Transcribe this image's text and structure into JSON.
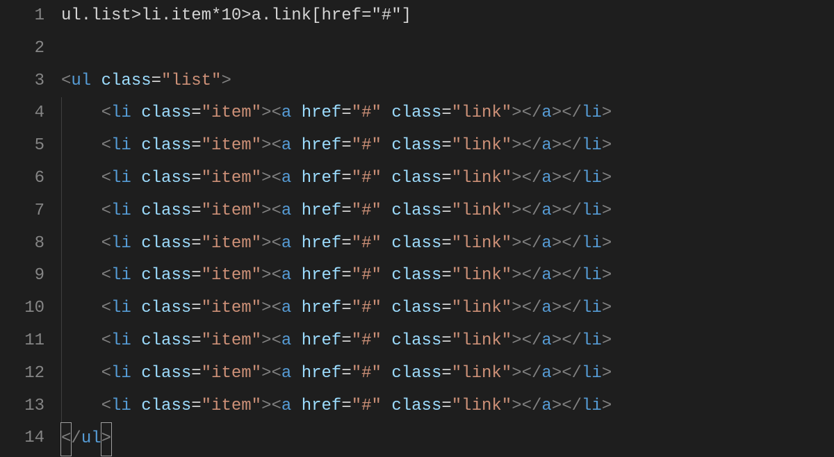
{
  "editor": {
    "line_numbers": [
      "1",
      "2",
      "3",
      "4",
      "5",
      "6",
      "7",
      "8",
      "9",
      "10",
      "11",
      "12",
      "13",
      "14"
    ],
    "emmet_line": "ul.list>li.item*10>a.link[href=\"#\"]",
    "ul_open": {
      "tag": "ul",
      "attr": "class",
      "val": "\"list\""
    },
    "li_rows": [
      0,
      1,
      2,
      3,
      4,
      5,
      6,
      7,
      8,
      9
    ],
    "li": {
      "tag": "li",
      "attr": "class",
      "val": "\"item\""
    },
    "a": {
      "tag": "a",
      "href_attr": "href",
      "href_val": "\"#\"",
      "class_attr": "class",
      "class_val": "\"link\""
    },
    "ul_close": {
      "tag": "ul"
    }
  },
  "colors": {
    "background": "#1e1e1e",
    "gutter": "#858585",
    "angle": "#808080",
    "tag": "#569cd6",
    "attr": "#9cdcfe",
    "string": "#ce9178",
    "plain": "#d4d4d4"
  }
}
